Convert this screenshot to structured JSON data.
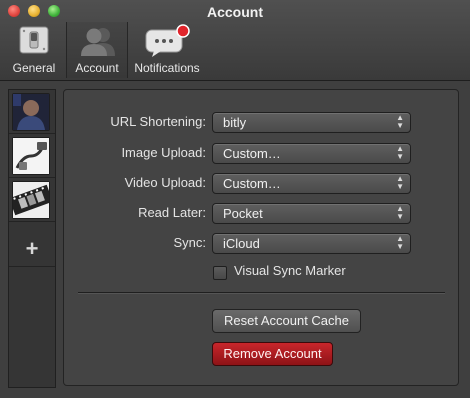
{
  "window": {
    "title": "Account"
  },
  "toolbar": {
    "tabs": [
      {
        "label": "General",
        "icon": "switch-icon"
      },
      {
        "label": "Account",
        "icon": "people-icon",
        "selected": true
      },
      {
        "label": "Notifications",
        "icon": "speech-bubble-icon",
        "badge_color": "#e0242b"
      }
    ]
  },
  "sidebar": {
    "accounts": [
      {
        "icon": "user-photo-icon"
      },
      {
        "icon": "cable-icon"
      },
      {
        "icon": "film-strip-icon"
      }
    ],
    "add_label": "+"
  },
  "form": {
    "rows": [
      {
        "label": "URL Shortening:",
        "value": "bitly"
      },
      {
        "label": "Image Upload:",
        "value": "Custom…"
      },
      {
        "label": "Video Upload:",
        "value": "Custom…"
      },
      {
        "label": "Read Later:",
        "value": "Pocket"
      },
      {
        "label": "Sync:",
        "value": "iCloud"
      }
    ],
    "visual_sync_marker": {
      "label": "Visual Sync Marker",
      "checked": false
    }
  },
  "buttons": {
    "reset_cache": "Reset Account Cache",
    "remove_account": "Remove Account"
  },
  "colors": {
    "remove_button": "#b51d22",
    "close": "#e0443e",
    "minimize": "#e7b02f",
    "zoom": "#3fb23a"
  }
}
